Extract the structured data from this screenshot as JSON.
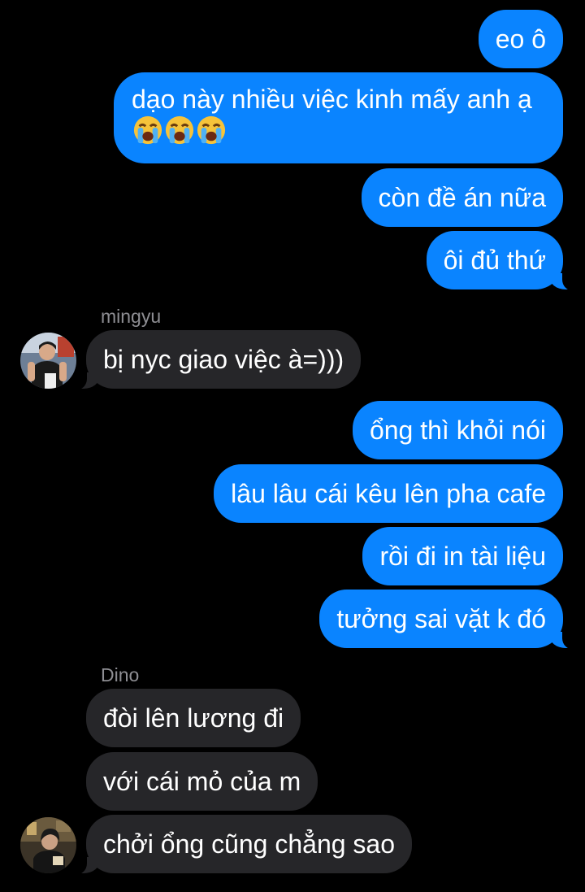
{
  "messages": {
    "m1": "eo ô",
    "m2": "dạo này nhiều việc kinh mấy anh ạ",
    "m3": "còn đề án nữa",
    "m4": "ôi đủ thứ",
    "m5": "bị nyc giao việc à=)))",
    "m6": "ổng thì khỏi nói",
    "m7": "lâu lâu cái kêu lên pha cafe",
    "m8": "rồi đi in tài liệu",
    "m9": "tưởng sai vặt k đó",
    "m10": "đòi lên lương đi",
    "m11": "với cái mỏ của m",
    "m12": "chởi ổng cũng chẳng sao"
  },
  "senders": {
    "mingyu": "mingyu",
    "dino": "Dino"
  },
  "emoji": {
    "name": "loudly-crying-face-emoji",
    "count": 3
  },
  "colors": {
    "outgoing": "#0a84ff",
    "incoming": "#262629",
    "background": "#000000",
    "sender_label": "#8e8e93"
  }
}
